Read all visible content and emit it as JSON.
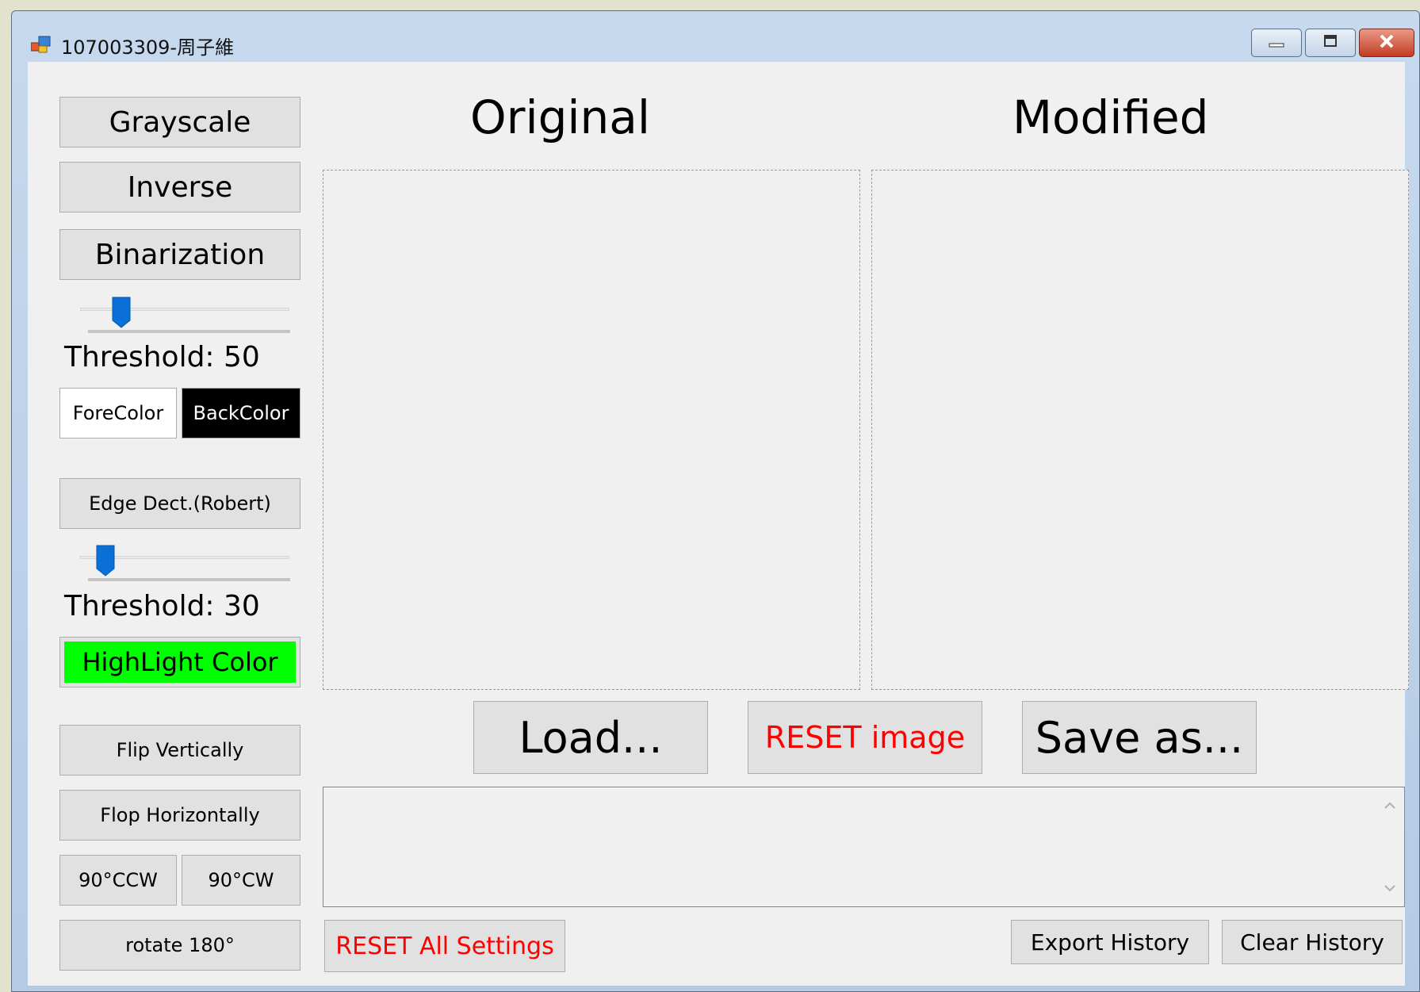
{
  "window": {
    "title": "107003309-周子維"
  },
  "left_panel": {
    "grayscale_label": "Grayscale",
    "inverse_label": "Inverse",
    "binarization_label": "Binarization",
    "binarization_threshold_text": "Threshold: 50",
    "binarization_threshold_value": 50,
    "forecolor_label": "ForeColor",
    "backcolor_label": "BackColor",
    "edge_detect_label": "Edge Dect.(Robert)",
    "edge_threshold_text": "Threshold: 30",
    "edge_threshold_value": 30,
    "highlight_color_label": "HighLight Color",
    "flip_vertically_label": "Flip Vertically",
    "flop_horizontally_label": "Flop Horizontally",
    "rotate_ccw_label": "90°CCW",
    "rotate_cw_label": "90°CW",
    "rotate_180_label": "rotate 180°"
  },
  "main": {
    "original_heading": "Original",
    "modified_heading": "Modified",
    "load_label": "Load...",
    "reset_image_label": "RESET image",
    "save_as_label": "Save as...",
    "reset_all_label": "RESET All Settings",
    "export_history_label": "Export History",
    "clear_history_label": "Clear History"
  },
  "colors": {
    "forecolor_swatch": "#ffffff",
    "backcolor_swatch": "#000000",
    "highlight_swatch": "#00ff00",
    "slider_thumb": "#0a6fd6",
    "reset_text": "#ff0000"
  },
  "icons": {
    "app": "app-window-icon",
    "minimize": "minimize-icon",
    "maximize": "maximize-icon",
    "close": "close-icon"
  }
}
